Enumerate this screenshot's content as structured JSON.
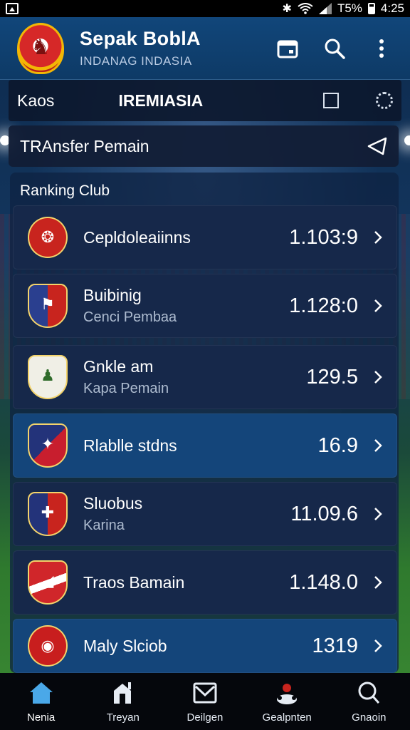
{
  "status_bar": {
    "battery_text": "T5%",
    "time": "4:25"
  },
  "header": {
    "title": "Sepak BoblA",
    "subtitle": "INDANAG INDASIA",
    "icons": [
      "calendar-icon",
      "search-icon",
      "more-vert-icon"
    ]
  },
  "tabs": {
    "left": "Kaos",
    "main": "IREMIASIA"
  },
  "transfer": {
    "label": "TRAnsfer Pemain"
  },
  "ranking": {
    "title": "Ranking Club",
    "clubs": [
      {
        "name": "Cepldoleaiinns",
        "sub": "",
        "score": "1.103:9",
        "crest_color": "#c8241e",
        "highlight": false
      },
      {
        "name": "Buibinig",
        "sub": "Cenci Pembaa",
        "score": "1.128:0",
        "crest_color": "#2a3f8f",
        "highlight": false
      },
      {
        "name": "Gnkle am",
        "sub": "Kapa Pemain",
        "score": "129.5",
        "crest_color": "#2f6b2a",
        "highlight": false
      },
      {
        "name": "Rlablle stdns",
        "sub": "",
        "score": "16.9",
        "crest_color": "#c81e2e",
        "highlight": true
      },
      {
        "name": "Sluobus",
        "sub": "Karina",
        "score": "11.09.6",
        "crest_color": "#23337a",
        "highlight": false
      },
      {
        "name": "Traos Bamain",
        "sub": "",
        "score": "1.148.0",
        "crest_color": "#d0262a",
        "highlight": false
      },
      {
        "name": "Maly Slciob",
        "sub": "",
        "score": "1319",
        "crest_color": "#c81e1e",
        "highlight": true
      }
    ]
  },
  "bottom_nav": [
    {
      "label": "Nenia",
      "icon": "home-icon",
      "active": true
    },
    {
      "label": "Treyan",
      "icon": "stats-icon",
      "active": false
    },
    {
      "label": "Deilgen",
      "icon": "inbox-icon",
      "active": false
    },
    {
      "label": "Gealpnten",
      "icon": "team-icon",
      "active": false
    },
    {
      "label": "Gnaoin",
      "icon": "search-icon",
      "active": false
    }
  ],
  "colors": {
    "header_bg": "#11467a",
    "row_bg": "#16284a",
    "row_highlight_bg": "#14457a",
    "nav_active": "#4aa8e8"
  }
}
